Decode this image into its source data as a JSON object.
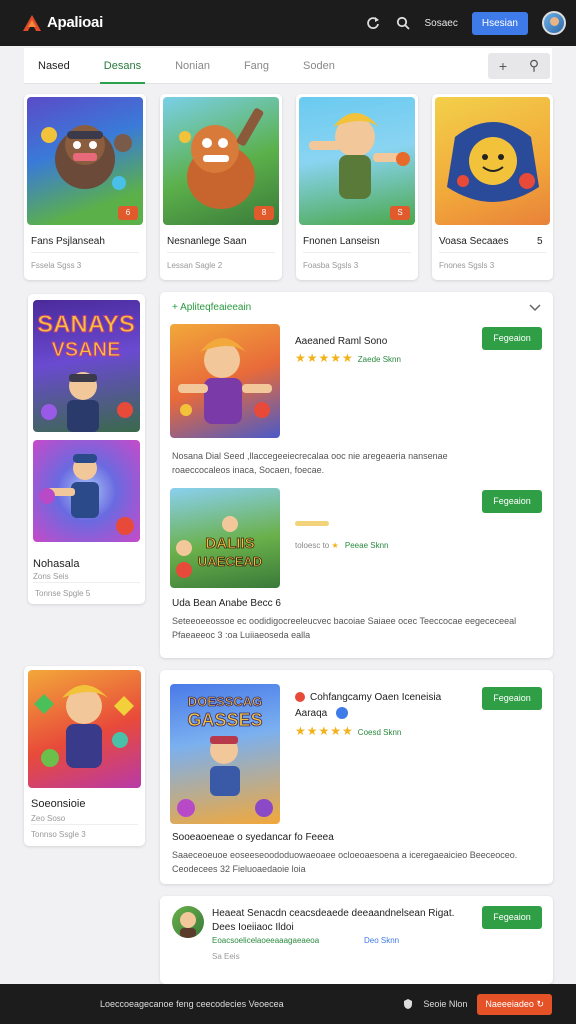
{
  "header": {
    "app_title": "Apalioai",
    "app_subtitle": "",
    "link_label": "Sosaec",
    "button_label": "Hsesian"
  },
  "tabs": [
    {
      "label": "Nased"
    },
    {
      "label": "Desans"
    },
    {
      "label": "Nonian"
    },
    {
      "label": "Fang"
    },
    {
      "label": "Soden"
    }
  ],
  "tab_actions": {
    "plus": "+",
    "search": "⚲"
  },
  "top_games": [
    {
      "title": "Fans Psjlanseah",
      "meta": "Fssela  Sgss 3",
      "badge": "6"
    },
    {
      "title": "Nesnanlege Saan",
      "meta": "Lessan  Sagle 2",
      "badge": "8"
    },
    {
      "title": "Fnonen Lanseisn",
      "meta": "Foasba  Sgsls 3",
      "badge": "S"
    },
    {
      "title": "Voasa Secaaes",
      "meta": "Fnones  Sgsls 3",
      "badge": ""
    }
  ],
  "top_games_extra": "5",
  "side_card_1": {
    "poster_text_1": "SANAYS",
    "poster_text_2": "VSANE",
    "title": "Nohasala",
    "meta1": "Zons Seis",
    "meta2": "Tonnse  Spgle 5"
  },
  "featured": {
    "section_title": "Apliteqfeaieeain",
    "section_plus": "+",
    "items": [
      {
        "title": "Aaeaned Raml Sono",
        "rating_text": "Zaede Sknn",
        "button": "Fegeaion",
        "desc": "Nosana  Dial Seed ,llaccegeeiecrecalaa ooc nie aregeaeria nansenae roaeccocaleos inaca, Socaen, foecae."
      },
      {
        "title": "Uda Bean Anabe Becc 6",
        "poster_text_1": "DALIIS",
        "poster_text_2": "UAECEAD",
        "rating_text": "Peeae Sknn",
        "meta_left": "toloesc  to",
        "button": "Fegeaion",
        "desc": "Seteeoeeossoe ec oodidigocreeleucvec bacoiae  Saiaee ocec Teeccocae eegececeeal  Pfaeaeeoc 3 :oa  Luiiaeoseda ealla"
      }
    ]
  },
  "side_card_2": {
    "title": "Soeonsioie",
    "meta1": "Zeo Soso",
    "meta2": "Tonnso  Ssgle 3"
  },
  "promo": {
    "poster_text_1": "DOESSCAG",
    "poster_text_2": "GASSES",
    "title": "Cohfangcamy Oaen Iceneisia",
    "title_line2": "Aaraqa",
    "rating_text": "Coesd Sknn",
    "button": "Fegeaion",
    "subtitle": "Sooeaoeneae o syedancar fo Feeea",
    "desc": "Saaeceoeuoe eoseeseoododuowaeoaee ocloeoaesoena a iceregaeaicieo Beeceoceo. Ceodecees   32 Fieluoaedaoie loia"
  },
  "comment": {
    "title": "Heaeat  Senacdn ceacsdeaede deeaandnelsean Rigat.",
    "title_line2": "Dees Ioeiiaoc Ildoi",
    "meta_left": "Eoacsoelicelaoeeaaagaeaeoa",
    "meta_right": "Deo Sknn",
    "meta_small": "Sa  Eeis",
    "button": "Fegeaion"
  },
  "footer": {
    "text": "Loeccoeagecanoe feng ceecodecies Veoecea",
    "link": "Seoie Nlon",
    "button": "Naeeeiadeo"
  },
  "colors": {
    "header_bg": "#1c1c1c",
    "accent_blue": "#3e7be8",
    "accent_green": "#2f9e45",
    "accent_orange": "#e65227",
    "star": "#f2b21a"
  }
}
